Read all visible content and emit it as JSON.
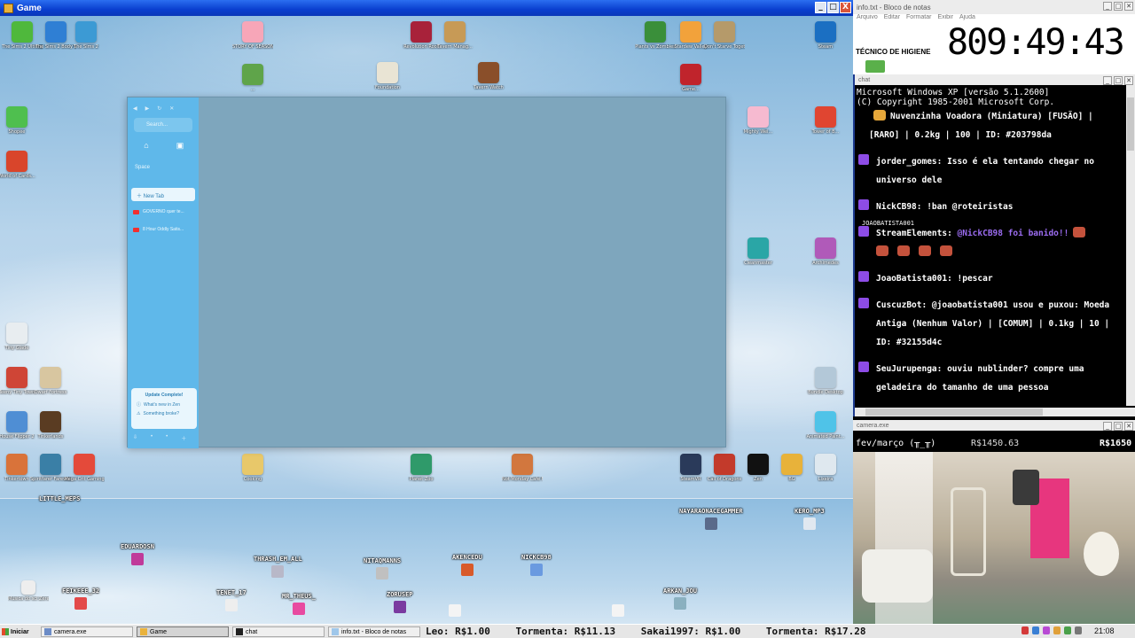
{
  "game_window": {
    "title": "Game",
    "controls": [
      "_",
      "□",
      "X"
    ]
  },
  "desktop_icons": [
    {
      "id": "sims2",
      "label": "The Sims 2 Ultimate...",
      "color": "#4fb83c"
    },
    {
      "id": "sims2bs",
      "label": "The Sims 2 Body Shop",
      "color": "#2f7fd4"
    },
    {
      "id": "sims2c",
      "label": "The Sims 2",
      "color": "#3c9ad4"
    },
    {
      "id": "story",
      "label": "STORY OF SEASONS...",
      "color": "#f7a6b8"
    },
    {
      "id": "greenbug",
      "label": "...",
      "color": "#5fa44a"
    },
    {
      "id": "revolution",
      "label": "Revolution Root",
      "color": "#a8223a"
    },
    {
      "id": "tavern",
      "label": "Tavern Manag...",
      "color": "#c79a56"
    },
    {
      "id": "foundation",
      "label": "Foundation",
      "color": "#e9e4d4"
    },
    {
      "id": "tavernwatch",
      "label": "Tavern Watch",
      "color": "#8a4f2a"
    },
    {
      "id": "plants",
      "label": "Plants vs Zombies",
      "color": "#3a8f3a"
    },
    {
      "id": "stardew",
      "label": "Stardew Valley",
      "color": "#f2a23b"
    },
    {
      "id": "dontstarve",
      "label": "Don't Starve Together",
      "color": "#b59a6a"
    },
    {
      "id": "steam",
      "label": "Steam",
      "color": "#1b6fc2"
    },
    {
      "id": "game2",
      "label": "Game...",
      "color": "#c0242c"
    },
    {
      "id": "marvel",
      "label": "Mighty Wei...",
      "color": "#f6bad0"
    },
    {
      "id": "tboi",
      "label": "Tower of B...",
      "color": "#e04531"
    },
    {
      "id": "shopee",
      "label": "Shopee",
      "color": "#4fbf4f"
    },
    {
      "id": "oneshot",
      "label": "World of Cards...",
      "color": "#d9452b"
    },
    {
      "id": "cleanmaster",
      "label": "Cleanmaster",
      "color": "#2aa6a6"
    },
    {
      "id": "archimedes",
      "label": "Archimedes",
      "color": "#b05ab9"
    },
    {
      "id": "tinyglade",
      "label": "Tiny Glade",
      "color": "#e8edf0"
    },
    {
      "id": "tinytiny",
      "label": "Teeny Tiny Town",
      "color": "#cf4536"
    },
    {
      "id": "factorio",
      "label": "Dwarf Fortress",
      "color": "#d8c6a0"
    },
    {
      "id": "house",
      "label": "House Flipper 2",
      "color": "#4f8ed4"
    },
    {
      "id": "wild",
      "label": "Tinkerlands",
      "color": "#5a3c22"
    },
    {
      "id": "bundle",
      "label": "Bundle Desktop",
      "color": "#b3c8d8"
    },
    {
      "id": "annihilated",
      "label": "Animated Paint...",
      "color": "#4fc3e8"
    },
    {
      "id": "tinkertown",
      "label": "Tinkertown",
      "color": "#d9733a"
    },
    {
      "id": "spiritfarer",
      "label": "Spiritfarer Farewell",
      "color": "#3a7fa6"
    },
    {
      "id": "mega",
      "label": "Mega Crit Gaming",
      "color": "#e44a3a"
    },
    {
      "id": "cooking",
      "label": "Cooking",
      "color": "#e8c86a"
    },
    {
      "id": "pinkapp",
      "label": "Planet Zoo",
      "color": "#2f9a6a"
    },
    {
      "id": "nomanday",
      "label": "Not Monday Cafe Flipper",
      "color": "#d2773e"
    },
    {
      "id": "steamvr",
      "label": "SteamVR",
      "color": "#2a3a5a"
    },
    {
      "id": "callof",
      "label": "Call of Dragons",
      "color": "#c33a2b"
    },
    {
      "id": "zen",
      "label": "Zen",
      "color": "#111111"
    },
    {
      "id": "bg",
      "label": "BG",
      "color": "#e8b23a"
    },
    {
      "id": "lixeira",
      "label": "Lixeira",
      "color": "#dfe8ef"
    },
    {
      "id": "wallpaper",
      "label": "Wallpaper...",
      "color": "#3a2a4a"
    },
    {
      "id": "cgi",
      "label": "Chrome",
      "color": "#1fa89a"
    }
  ],
  "browser": {
    "search_placeholder": "Search...",
    "space_label": "Space",
    "new_tab_label": "New Tab",
    "tabs": [
      {
        "label": "GOVERNO quer te..."
      },
      {
        "label": "8 Hour Oddly Satis..."
      }
    ],
    "update": {
      "title": "Update Complete!",
      "link1": "What's new in Zen",
      "link2": "Something broke?"
    }
  },
  "stream_overlay": {
    "top_label": "LITTLE_MEPS",
    "chatters": [
      {
        "name": "EDUARDOSN",
        "color": "#c03a9a"
      },
      {
        "name": "FEIKEEE_32",
        "color": "#e34a4a"
      },
      {
        "name": "TENET_17",
        "color": "#eeeeee"
      },
      {
        "name": "THRASH_EM_ALL",
        "color": "#b8b8c8"
      },
      {
        "name": "MR_THEUS_",
        "color": "#e84aa0"
      },
      {
        "name": "NITAQMANNS",
        "color": "#c0c0c0"
      },
      {
        "name": "ZORUSEP",
        "color": "#7a3aa0"
      },
      {
        "name": "AKENCEDU",
        "color": "#d85a2a"
      },
      {
        "name": "NICKCB98",
        "color": "#6a9ae0"
      },
      {
        "name": "ARKAN_JOU",
        "color": "#8ab0c0"
      },
      {
        "name": "NAYARAONACEGAMMER",
        "color": "#5a6a8a"
      },
      {
        "name": "KERO_MP3",
        "color": "#e0e8f0"
      },
      {
        "name": "",
        "color": "#f4f4f4"
      },
      {
        "name": "",
        "color": "#f4f4f4"
      }
    ],
    "desktop_shortcut": "Música do sci Zere"
  },
  "notepad": {
    "title": "info.txt - Bloco de notas",
    "menu": [
      "Arquivo",
      "Editar",
      "Formatar",
      "Exibir",
      "Ajuda"
    ],
    "label": "TÉCNICO DE HIGIENE",
    "timer": "809:49:43"
  },
  "chat": {
    "title": "chat",
    "header_line1": "Microsoft Windows XP [versão 5.1.2600]",
    "header_line2": "(C) Copyright 1985-2001 Microsoft Corp.",
    "messages": [
      {
        "text": "Nuvenzinha Voadora (Miniatura) [FUSÃO] | [RARO] | 0.2kg | 100 | ID: #203798da"
      },
      {
        "user": "jorder_gomes:",
        "text": " Isso é ela tentando chegar no universo dele"
      },
      {
        "user": "NickCB98:",
        "text": " !ban @roteiristas"
      },
      {
        "tag": "JOAOBATISTA001",
        "user": "StreamElements:",
        "mention": " @NickCB98 foi banido!!"
      },
      {
        "user": "JoaoBatista001:",
        "text": " !pescar"
      },
      {
        "user": "CuscuzBot:",
        "text": " @joaobatista001 usou  e puxou:  Moeda Antiga (Nenhum Valor) | [COMUM] | 0.1kg | 10 | ID: #32155d4c"
      },
      {
        "user": "SeuJurupenga:",
        "text": " ouviu nublinder? compre uma geladeira do tamanho de uma pessoa"
      }
    ]
  },
  "camera": {
    "title": "camera.exe",
    "left_text": "fev/março (╥_╥)",
    "mid_text": "R$1450.63",
    "right_text": "R$1650"
  },
  "taskbar": {
    "start_label": "Iniciar",
    "tasks": [
      {
        "label": "camera.exe"
      },
      {
        "label": "Game"
      },
      {
        "label": "chat"
      },
      {
        "label": "info.txt - Bloco de notas"
      }
    ],
    "ticker": [
      "Leo: R$1.00",
      "Tormenta: R$11.13",
      "Sakai1997: R$1.00",
      "Tormenta: R$17.28"
    ],
    "clock": "21:08"
  }
}
